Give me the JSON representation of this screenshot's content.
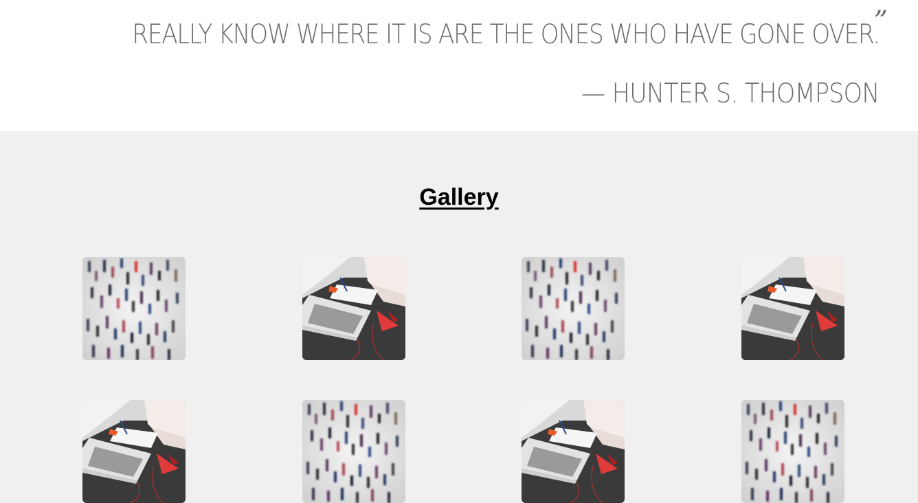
{
  "quote": {
    "text_tail": "REALLY KNOW WHERE IT IS ARE THE ONES WHO HAVE GONE OVER.",
    "close_mark": "”",
    "author": "— HUNTER S. THOMPSON"
  },
  "gallery": {
    "title": "Gallery",
    "items": [
      {
        "image": "crowd-photo"
      },
      {
        "image": "laptop-photo"
      },
      {
        "image": "crowd-photo"
      },
      {
        "image": "laptop-photo"
      },
      {
        "image": "laptop-photo"
      },
      {
        "image": "crowd-photo"
      },
      {
        "image": "laptop-photo"
      },
      {
        "image": "crowd-photo"
      }
    ]
  }
}
